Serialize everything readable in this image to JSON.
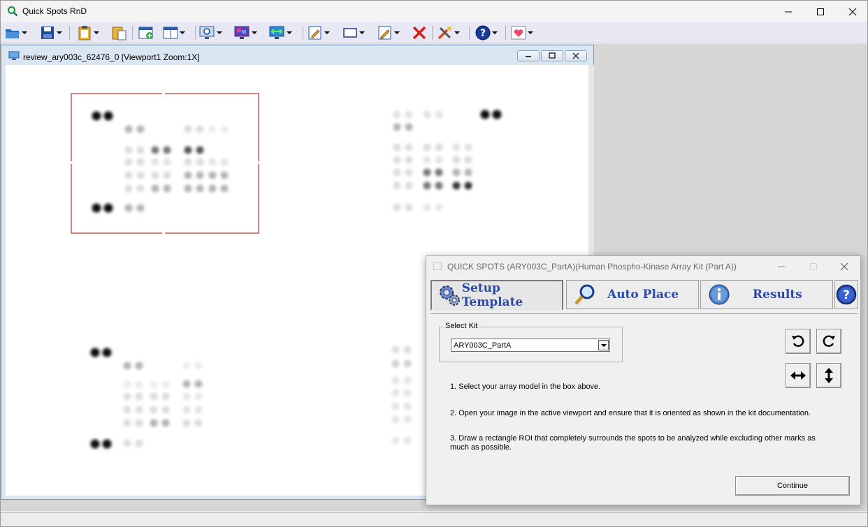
{
  "app": {
    "title": "Quick Spots RnD"
  },
  "toolbar": {
    "items": [
      {
        "name": "open",
        "icon": "open-folder-icon"
      },
      {
        "name": "save",
        "icon": "save-disk-icon"
      },
      {
        "name": "paste",
        "icon": "clipboard-icon"
      },
      {
        "name": "copy",
        "icon": "clipboard-copy-icon"
      },
      {
        "name": "new-viewport",
        "icon": "new-window-icon"
      },
      {
        "name": "layout",
        "icon": "split-panes-icon"
      },
      {
        "name": "zoom",
        "icon": "magnifier-monitor-icon"
      },
      {
        "name": "display",
        "icon": "colored-monitor-icon"
      },
      {
        "name": "swap",
        "icon": "arrows-monitor-icon"
      },
      {
        "name": "edit",
        "icon": "pencil-note-icon"
      },
      {
        "name": "rectangle",
        "icon": "rectangle-icon"
      },
      {
        "name": "edit-roi",
        "icon": "pencil-icon"
      },
      {
        "name": "delete",
        "icon": "red-x-icon"
      },
      {
        "name": "tools",
        "icon": "tools-icon"
      },
      {
        "name": "help",
        "icon": "help-icon"
      },
      {
        "name": "health",
        "icon": "heart-icon"
      }
    ]
  },
  "viewport": {
    "title": "review_ary003c_62476_0 [Viewport1 Zoom:1X]"
  },
  "dialog": {
    "title": "QUICK SPOTS (ARY003C_PartA)(Human Phospho-Kinase Array Kit (Part A))",
    "tabs": [
      {
        "label": "Setup Template",
        "icon": "gear-icon",
        "active": true
      },
      {
        "label": "Auto Place",
        "icon": "magnifier-icon",
        "active": false
      },
      {
        "label": "Results",
        "icon": "info-icon",
        "active": false
      }
    ],
    "help_icon": "help-icon",
    "select_kit": {
      "label": "Select Kit",
      "value": "ARY003C_PartA"
    },
    "instructions": [
      "1. Select your array model in the box above.",
      "2. Open your image in the active viewport and ensure that it is oriented as shown in the kit documentation.",
      "3. Draw a rectangle ROI that completely surrounds the spots to be analyzed while excluding other marks as much as possible."
    ],
    "orientation_buttons": [
      {
        "name": "rotate-ccw",
        "icon": "rotate-ccw-icon"
      },
      {
        "name": "rotate-cw",
        "icon": "rotate-cw-icon"
      },
      {
        "name": "flip-horizontal",
        "icon": "flip-horizontal-icon"
      },
      {
        "name": "flip-vertical",
        "icon": "flip-vertical-icon"
      }
    ],
    "continue_label": "Continue"
  },
  "colors": {
    "roi": "#c0302a",
    "tab_text": "#2d4aa8",
    "toolbar_bg": "#e8e8f4"
  }
}
